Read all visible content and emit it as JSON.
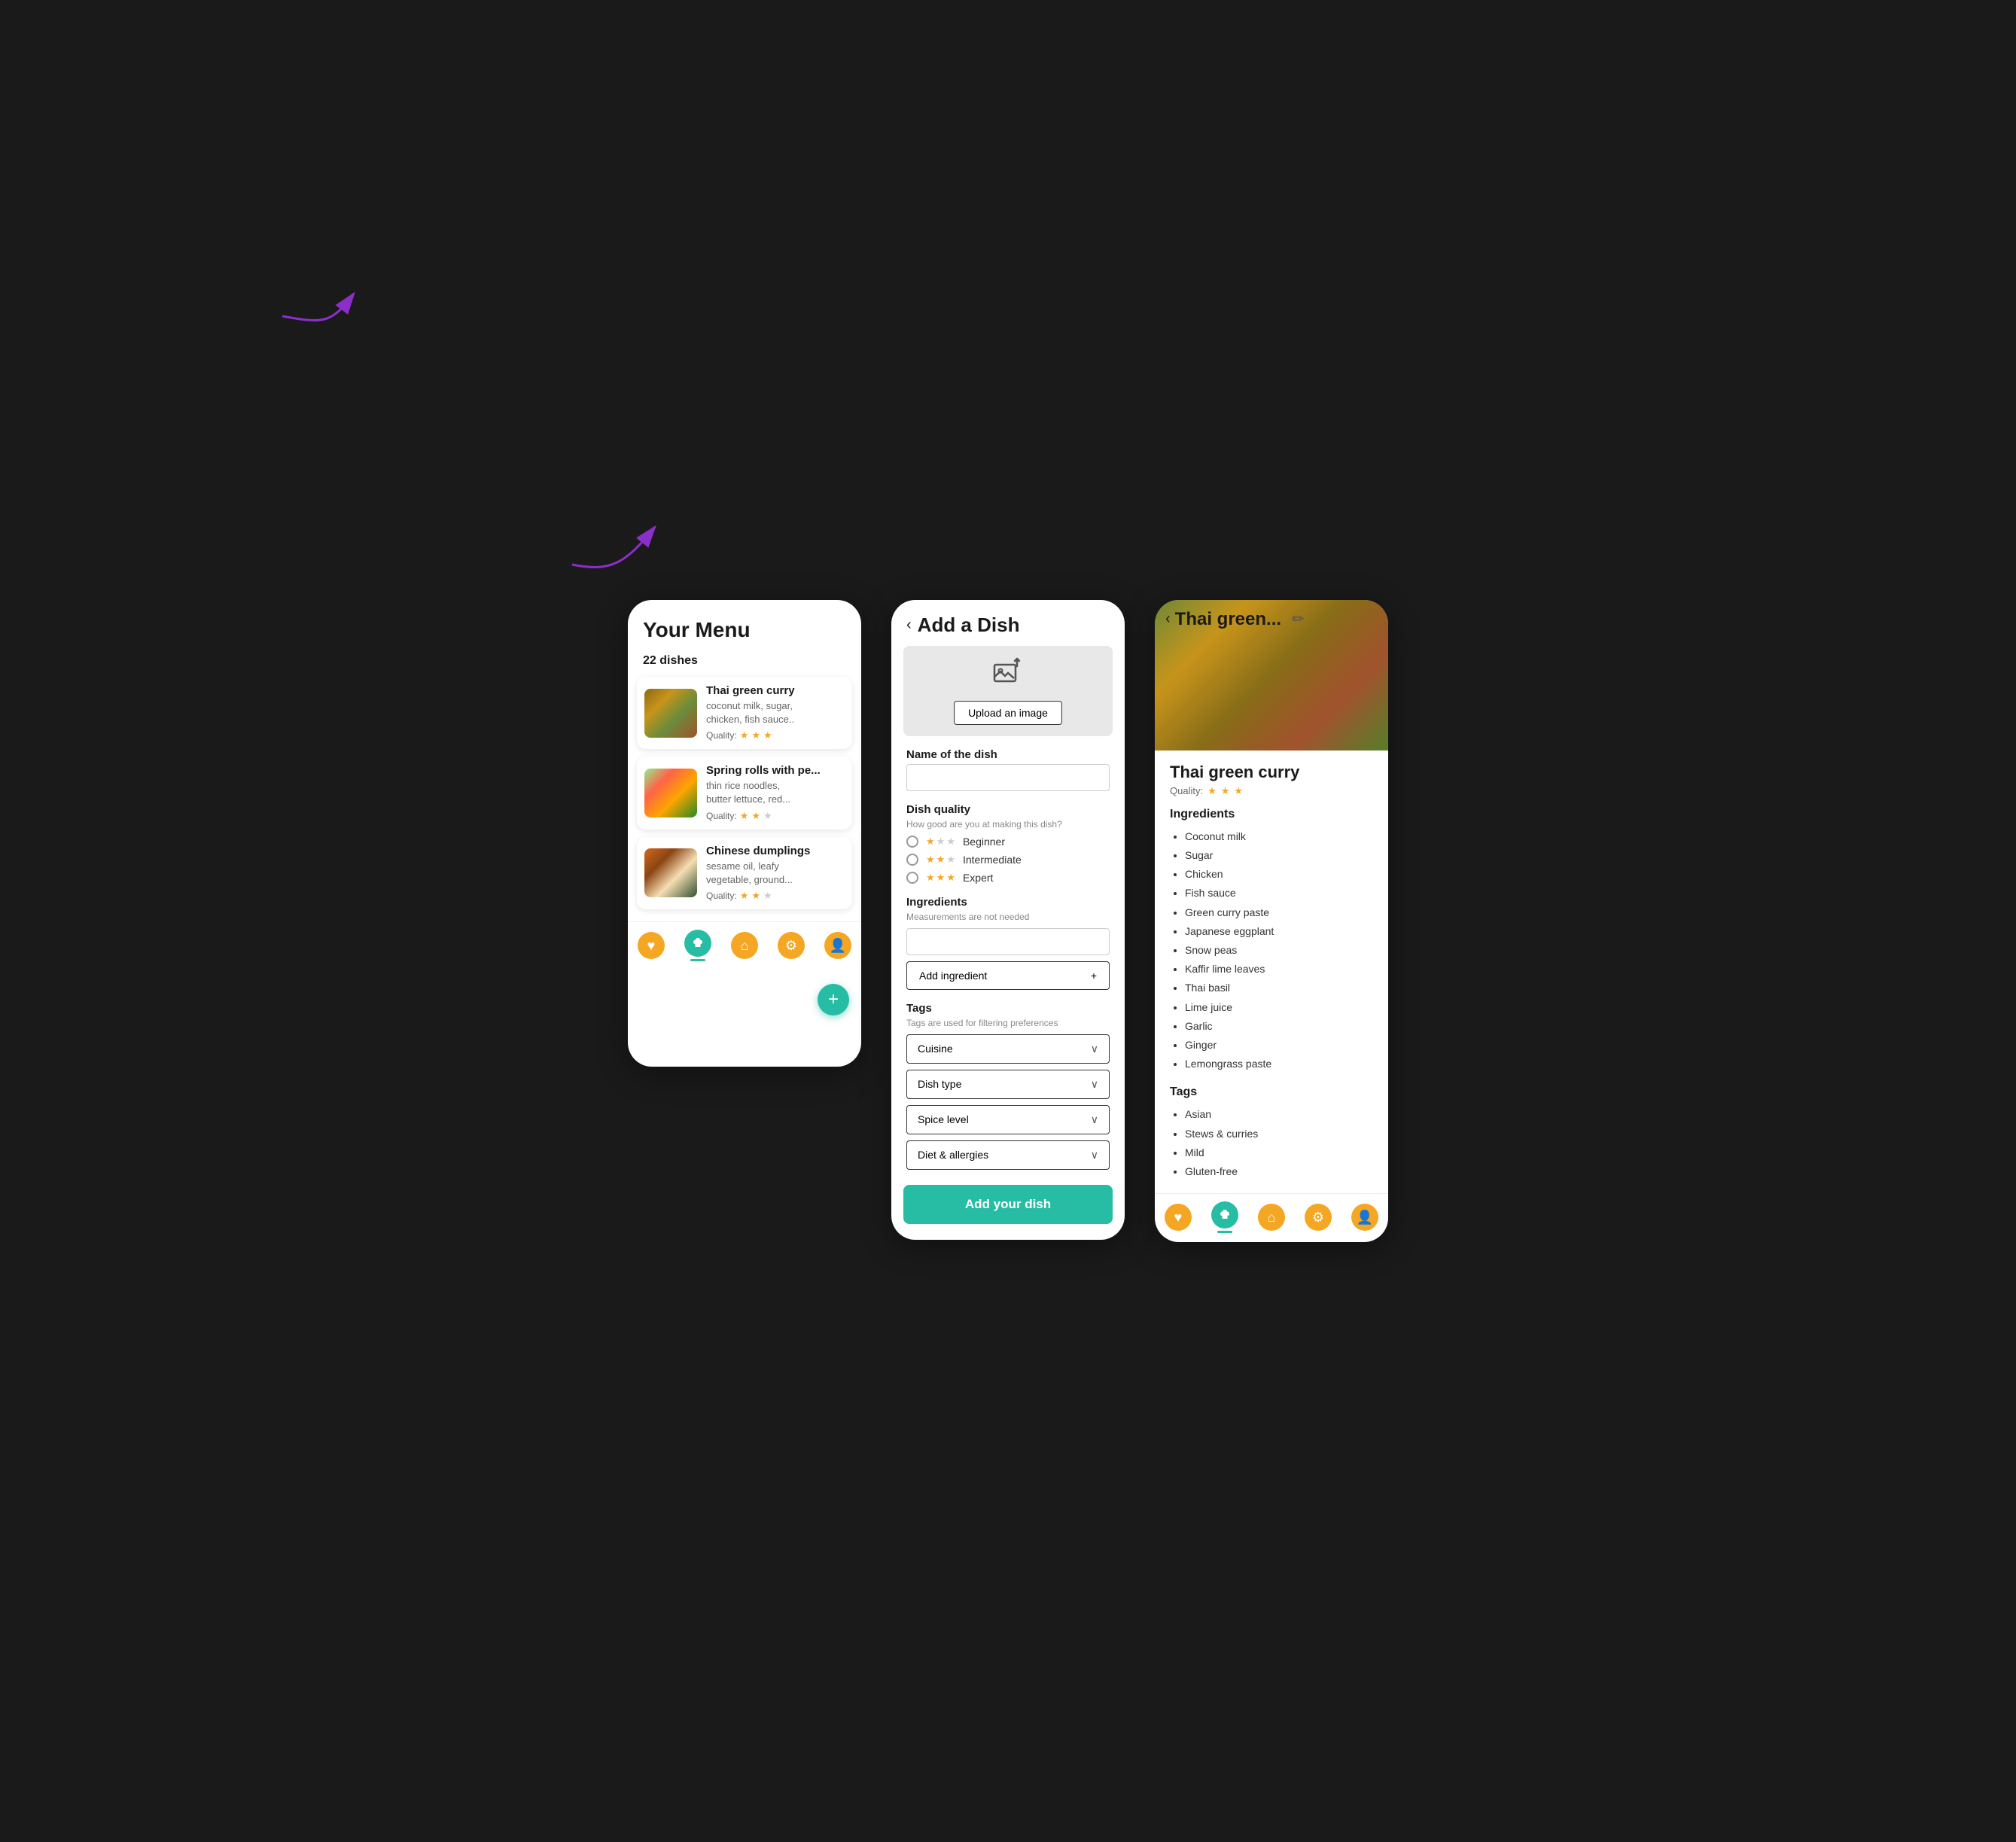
{
  "screens": {
    "menu": {
      "title": "Your Menu",
      "dish_count": "22 dishes",
      "dishes": [
        {
          "name": "Thai green curry",
          "ingredients": "coconut milk, sugar,\nchicken, fish sauce..",
          "quality_label": "Quality:",
          "stars": [
            true,
            true,
            true,
            false,
            false
          ],
          "img_class": "dish-img-curry"
        },
        {
          "name": "Spring rolls with pe...",
          "ingredients": "thin rice noodles,\nbutter lettuce, red...",
          "quality_label": "Quality:",
          "stars": [
            true,
            true,
            false,
            false,
            false
          ],
          "img_class": "dish-img-spring"
        },
        {
          "name": "Chinese dumplings",
          "ingredients": "sesame oil, leafy\nvegetable, ground...",
          "quality_label": "Quality:",
          "stars": [
            true,
            true,
            false,
            false,
            false
          ],
          "img_class": "dish-img-dumplings"
        }
      ],
      "fab_label": "+",
      "nav_items": [
        "heart",
        "chef-hat",
        "home",
        "filters",
        "person"
      ]
    },
    "add_dish": {
      "back_arrow": "‹",
      "title": "Add a Dish",
      "upload_btn_label": "Upload an image",
      "name_label": "Name of the dish",
      "quality_label": "Dish quality",
      "quality_sublabel": "How good are you at making this dish?",
      "quality_options": [
        {
          "label": "Beginner",
          "stars": [
            true,
            false,
            false
          ]
        },
        {
          "label": "Intermediate",
          "stars": [
            true,
            true,
            false
          ]
        },
        {
          "label": "Expert",
          "stars": [
            true,
            true,
            true
          ]
        }
      ],
      "ingredients_label": "Ingredients",
      "ingredients_sublabel": "Measurements are not needed",
      "add_ingredient_label": "Add ingredient",
      "add_ingredient_icon": "+",
      "tags_label": "Tags",
      "tags_sublabel": "Tags are used for filtering preferences",
      "tag_dropdowns": [
        {
          "label": "Cuisine"
        },
        {
          "label": "Dish type"
        },
        {
          "label": "Spice level"
        },
        {
          "label": "Diet & allergies"
        }
      ],
      "submit_btn": "Add your dish"
    },
    "detail": {
      "back_arrow": "‹",
      "title": "Thai green...",
      "edit_icon": "✏",
      "dish_name": "Thai green curry",
      "quality_label": "Quality:",
      "quality_stars": [
        true,
        true,
        true,
        false,
        false
      ],
      "ingredients_title": "Ingredients",
      "ingredients": [
        "Coconut milk",
        "Sugar",
        "Chicken",
        "Fish sauce",
        "Green curry paste",
        "Japanese eggplant",
        "Snow peas",
        "Kaffir lime leaves",
        "Thai basil",
        "Lime juice",
        "Garlic",
        "Ginger",
        "Lemongrass paste"
      ],
      "tags_title": "Tags",
      "tags": [
        "Asian",
        "Stews & curries",
        "Mild",
        "Gluten-free"
      ]
    }
  }
}
